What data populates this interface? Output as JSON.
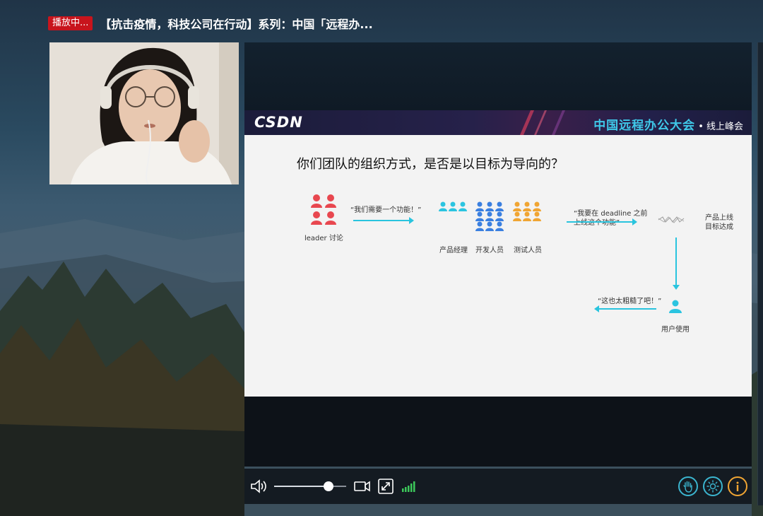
{
  "header": {
    "live_badge": "播放中...",
    "title": "【抗击疫情，科技公司在行动】系列：中国「远程办..."
  },
  "slide": {
    "logo": "CSDN",
    "summit_title": "中国远程办公大会",
    "summit_subtitle": "• 线上峰会",
    "question": "你们团队的组织方式，是否是以目标为导向的？",
    "leader_label": "leader 讨论",
    "quote_need_feature": "“我们需要一个功能！”",
    "pm_label": "产品经理",
    "dev_label": "开发人员",
    "test_label": "测试人员",
    "quote_deadline_line1": "“我要在 deadline 之前",
    "quote_deadline_line2": "上线这个功能”",
    "launch_label_line1": "产品上线",
    "launch_label_line2": "目标达成",
    "quote_rough": "“这也太粗糙了吧！”",
    "user_label": "用户使用"
  },
  "colors": {
    "live_red": "#c8141c",
    "leader_red": "#e8474f",
    "pm_cyan": "#2bc4e0",
    "dev_blue": "#3a7fe0",
    "test_orange": "#f0a533",
    "arrow_cyan": "#29c4de",
    "summit_cyan": "#3fc8e8",
    "control_accent": "#3bb5cf",
    "info_orange": "#f0a533",
    "signal_green": "#3cc85a"
  },
  "controls": {
    "volume_level": 0.75,
    "icons": [
      "volume-icon",
      "camera-icon",
      "fullscreen-exit-icon",
      "signal-icon",
      "raise-hand-icon",
      "brightness-icon",
      "info-icon"
    ]
  }
}
